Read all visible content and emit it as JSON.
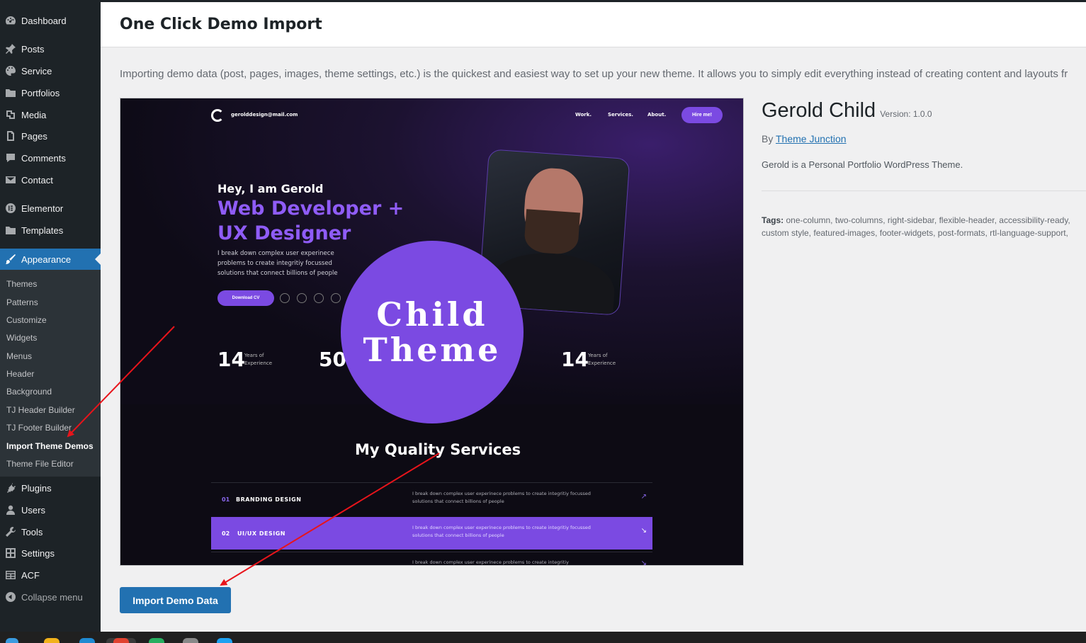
{
  "sidebar": {
    "menu": [
      {
        "label": "Dashboard",
        "icon": "dashboard-icon"
      },
      {
        "label": "Posts",
        "icon": "pin-icon"
      },
      {
        "label": "Service",
        "icon": "palette-icon"
      },
      {
        "label": "Portfolios",
        "icon": "folder-icon"
      },
      {
        "label": "Media",
        "icon": "media-icon"
      },
      {
        "label": "Pages",
        "icon": "pages-icon"
      },
      {
        "label": "Comments",
        "icon": "comment-icon"
      },
      {
        "label": "Contact",
        "icon": "mail-icon"
      },
      {
        "label": "Elementor",
        "icon": "elementor-icon"
      },
      {
        "label": "Templates",
        "icon": "folder-icon"
      },
      {
        "label": "Appearance",
        "icon": "brush-icon"
      },
      {
        "label": "Plugins",
        "icon": "plug-icon"
      },
      {
        "label": "Users",
        "icon": "user-icon"
      },
      {
        "label": "Tools",
        "icon": "wrench-icon"
      },
      {
        "label": "Settings",
        "icon": "settings-icon"
      },
      {
        "label": "ACF",
        "icon": "grid-icon"
      },
      {
        "label": "Collapse menu",
        "icon": "collapse-icon"
      }
    ],
    "submenu": [
      "Themes",
      "Patterns",
      "Customize",
      "Widgets",
      "Menus",
      "Header",
      "Background",
      "TJ Header Builder",
      "TJ Footer Builder",
      "Import Theme Demos",
      "Theme File Editor"
    ]
  },
  "header": {
    "title": "One Click Demo Import"
  },
  "intro": "Importing demo data (post, pages, images, theme settings, etc.) is the quickest and easiest way to set up your new theme. It allows you to simply edit everything instead of creating content and layouts fr",
  "preview": {
    "email": "gerolddesign@mail.com",
    "nav": [
      "Work.",
      "Services.",
      "About."
    ],
    "hire": "Hire me!",
    "greeting": "Hey, I am Gerold",
    "role1": "Web Developer +",
    "role2": "UX Designer",
    "blurb": [
      "I break down complex user experinece",
      "problems to create integritiy focussed",
      "solutions that connect billions of people"
    ],
    "download": "Download CV",
    "stats": [
      {
        "num": "14",
        "label1": "Years of",
        "label2": "Experience"
      },
      {
        "num": "50",
        "label1": "",
        "label2": ""
      },
      {
        "num": "14",
        "label1": "Years of",
        "label2": "Experience"
      }
    ],
    "overlay": [
      "Child",
      "Theme"
    ],
    "services_title": "My Quality Services",
    "services": [
      {
        "num": "01",
        "name": "BRANDING DESIGN",
        "desc": "I break down complex user experinece problems to create integritiy focussed solutions that connect billions of people",
        "arrow": "↗"
      },
      {
        "num": "02",
        "name": "UI/UX DESIGN",
        "desc": "I break down complex user experinece problems to create integritiy focussed solutions that connect billions of people",
        "arrow": "↘"
      },
      {
        "num": "",
        "name": "",
        "desc": "I break down complex user experinece problems to create integritiy",
        "arrow": "↘"
      }
    ]
  },
  "theme": {
    "name": "Gerold Child",
    "version": "Version: 1.0.0",
    "by": "By",
    "author": "Theme Junction",
    "description": "Gerold is a Personal Portfolio WordPress Theme.",
    "tags_label": "Tags:",
    "tags": "one-column, two-columns, right-sidebar, flexible-header, accessibility-ready, custom style, featured-images, footer-widgets, post-formats, rtl-language-support, sticky-post, th"
  },
  "button": {
    "label": "Import Demo Data"
  },
  "colors": {
    "accent": "#2271b1",
    "sidebar": "#1d2327",
    "purple": "#7b4ae2",
    "arrow": "#e8141b"
  }
}
